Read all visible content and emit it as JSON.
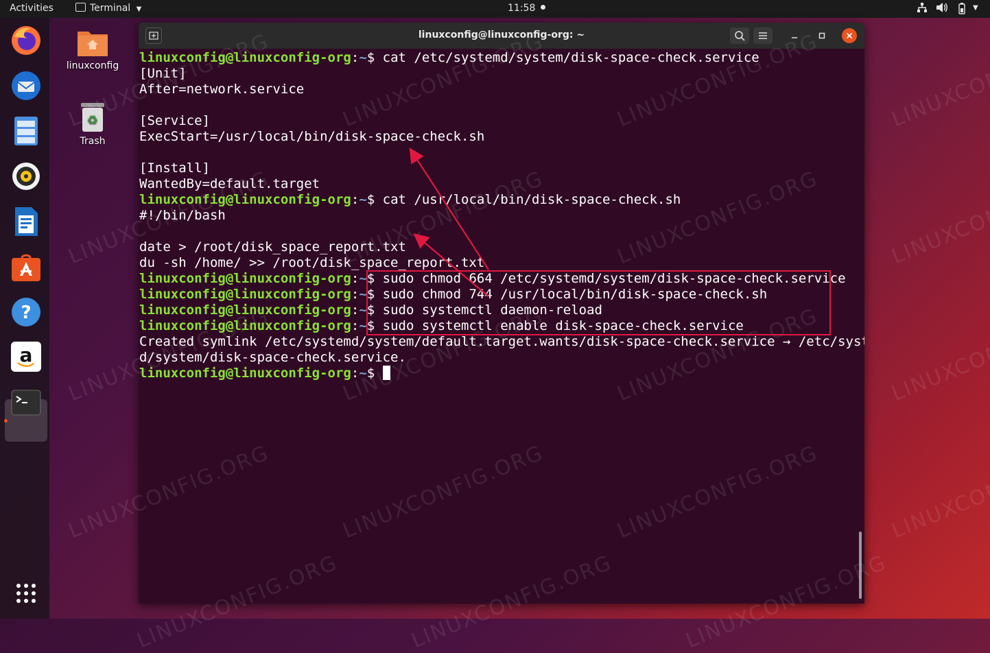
{
  "topbar": {
    "activities": "Activities",
    "app_menu": "Terminal",
    "clock": "11:58"
  },
  "desktop": {
    "home_label": "linuxconfig",
    "trash_label": "Trash"
  },
  "dock": {
    "amazon_letter": "a"
  },
  "window": {
    "title": "linuxconfig@linuxconfig-org: ~"
  },
  "terminal": {
    "prompt_user": "linuxconfig@linuxconfig-org",
    "prompt_sep": ":",
    "prompt_path": "~",
    "prompt_end": "$ ",
    "lines": [
      {
        "type": "cmd",
        "text": "cat /etc/systemd/system/disk-space-check.service"
      },
      {
        "type": "out",
        "text": "[Unit]"
      },
      {
        "type": "out",
        "text": "After=network.service"
      },
      {
        "type": "out",
        "text": ""
      },
      {
        "type": "out",
        "text": "[Service]"
      },
      {
        "type": "out",
        "text": "ExecStart=/usr/local/bin/disk-space-check.sh"
      },
      {
        "type": "out",
        "text": ""
      },
      {
        "type": "out",
        "text": "[Install]"
      },
      {
        "type": "out",
        "text": "WantedBy=default.target"
      },
      {
        "type": "cmd",
        "text": "cat /usr/local/bin/disk-space-check.sh"
      },
      {
        "type": "out",
        "text": "#!/bin/bash"
      },
      {
        "type": "out",
        "text": ""
      },
      {
        "type": "out",
        "text": "date > /root/disk_space_report.txt"
      },
      {
        "type": "out",
        "text": "du -sh /home/ >> /root/disk_space_report.txt"
      },
      {
        "type": "cmd",
        "text": "sudo chmod 664 /etc/systemd/system/disk-space-check.service"
      },
      {
        "type": "cmd",
        "text": "sudo chmod 744 /usr/local/bin/disk-space-check.sh"
      },
      {
        "type": "cmd",
        "text": "sudo systemctl daemon-reload"
      },
      {
        "type": "cmd",
        "text": "sudo systemctl enable disk-space-check.service"
      },
      {
        "type": "out",
        "text": "Created symlink /etc/systemd/system/default.target.wants/disk-space-check.service → /etc/system"
      },
      {
        "type": "out",
        "text": "d/system/disk-space-check.service."
      },
      {
        "type": "cursor",
        "text": ""
      }
    ]
  },
  "watermark": "LINUXCONFIG.ORG",
  "colors": {
    "prompt_user": "#8ae234",
    "prompt_path": "#729fcf",
    "terminal_bg": "#300a24",
    "highlight": "#e0183f"
  }
}
